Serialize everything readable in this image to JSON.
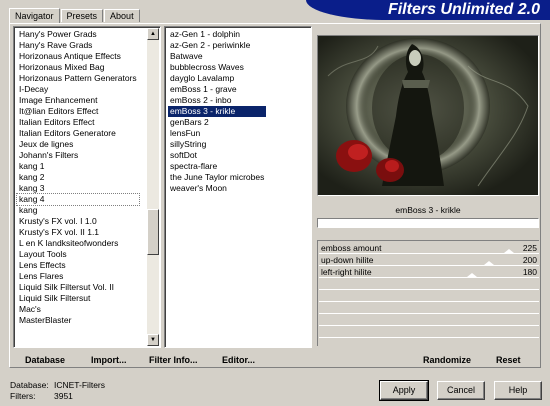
{
  "tabs": [
    "Navigator",
    "Presets",
    "About"
  ],
  "banner_title": "Filters Unlimited 2.0",
  "categories": [
    "Hany's Power Grads",
    "Hany's Rave Grads",
    "Horizonaus Antique Effects",
    "Horizonaus Mixed Bag",
    "Horizonaus Pattern Generators",
    "I-Decay",
    "Image Enhancement",
    "It@lian Editors Effect",
    "Italian Editors Effect",
    "Italian Editors Generatore",
    "Jeux de lignes",
    "Johann's Filters",
    "kang 1",
    "kang 2",
    "kang 3",
    "kang 4",
    "kang",
    "Krusty's FX vol. I 1.0",
    "Krusty's FX vol. II 1.1",
    "L en K landksiteofwonders",
    "Layout Tools",
    "Lens Effects",
    "Lens Flares",
    "Liquid Silk Filtersut Vol. II",
    "Liquid Silk Filtersut",
    "Mac's",
    "MasterBlaster"
  ],
  "selected_category": "kang 4",
  "filters": [
    "az-Gen 1  -  dolphin",
    "az-Gen 2  -  periwinkle",
    "Batwave",
    "bubblecross Waves",
    "dayglo Lavalamp",
    "emBoss 1  -  grave",
    "emBoss 2  -  inbo",
    "emBoss 3  -  krikle",
    "genBars 2",
    "lensFun",
    "sillyString",
    "softDot",
    "spectra-flare",
    "the June Taylor microbes",
    "weaver's Moon"
  ],
  "selected_filter": "emBoss 3  -  krikle",
  "filter_caption": "emBoss 3  -  krikle",
  "params": [
    {
      "label": "emboss amount",
      "value": "225",
      "level": 225
    },
    {
      "label": "up-down hilite",
      "value": "200",
      "level": 200
    },
    {
      "label": "left-right hilite",
      "value": "180",
      "level": 180
    }
  ],
  "bottom_links": {
    "database": "Database",
    "import": "Import...",
    "filter_info": "Filter Info...",
    "editor": "Editor...",
    "randomize": "Randomize",
    "reset": "Reset"
  },
  "status": {
    "database_label": "Database:",
    "database_value": "ICNET-Filters",
    "filters_label": "Filters:",
    "filters_value": "3951"
  },
  "buttons": {
    "apply": "Apply",
    "cancel": "Cancel",
    "help": "Help"
  },
  "colors": {
    "banner": "#0a1e8a",
    "selection": "#0a246a",
    "face": "#d4d0c8"
  },
  "icons": {
    "scroll_up": "up-arrow-icon",
    "scroll_down": "down-arrow-icon"
  }
}
